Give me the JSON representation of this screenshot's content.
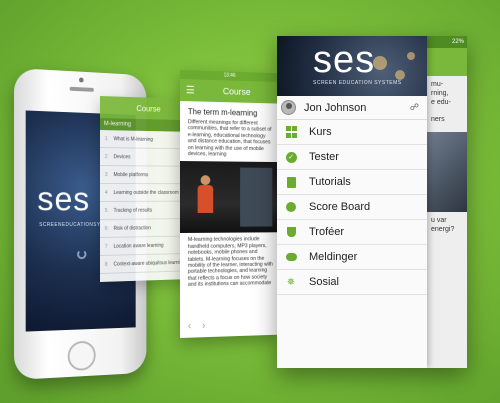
{
  "brand": {
    "logo": "ses",
    "tagline": "SCREEN EDUCATION SYSTEMS",
    "accent_color": "#79b83a"
  },
  "iphone": {
    "logo": "ses",
    "tagline": "SCREENEDUCATIONSYSTEMS"
  },
  "course_list": {
    "title": "Course",
    "section": "M-learning",
    "items": [
      {
        "n": "1",
        "label": "What is M-learning"
      },
      {
        "n": "2",
        "label": "Devices"
      },
      {
        "n": "3",
        "label": "Mobile platforms"
      },
      {
        "n": "4",
        "label": "Learning outside the classroom"
      },
      {
        "n": "5",
        "label": "Tracking of results"
      },
      {
        "n": "6",
        "label": "Risk of distraction"
      },
      {
        "n": "7",
        "label": "Location aware learning"
      },
      {
        "n": "8",
        "label": "Context-aware ubiquitous learning"
      }
    ]
  },
  "course_article": {
    "time": "13:46",
    "title": "Course",
    "heading": "The term m-learning",
    "intro": "Different meanings for different communities, that refer to a subset of e-learning, educational technology and distance education, that focuses on learning with the use of mobile devices, learning",
    "body": "M-learning technologies include handheld computers, MP3 players, notebooks, mobile phones and tablets. M-learning focuses on the mobility of the learner, interacting with portable technologies, and learning that reflects a focus on how society and its institutions can accommodate",
    "nav_prev": "‹",
    "nav_next": "›"
  },
  "drawer": {
    "status": "22%",
    "user_name": "Jon Johnson",
    "user_link_icon": "link-icon",
    "items": [
      {
        "label": "Kurs",
        "icon": "grid-icon"
      },
      {
        "label": "Tester",
        "icon": "check-circle-icon"
      },
      {
        "label": "Tutorials",
        "icon": "book-icon"
      },
      {
        "label": "Score Board",
        "icon": "dot-icon"
      },
      {
        "label": "Troféer",
        "icon": "trophy-icon"
      },
      {
        "label": "Meldinger",
        "icon": "chat-icon"
      },
      {
        "label": "Sosial",
        "icon": "social-icon"
      }
    ],
    "background_snippets": [
      "mu-",
      "rning,",
      "e edu-",
      "ners",
      "u var",
      "energi?"
    ]
  }
}
